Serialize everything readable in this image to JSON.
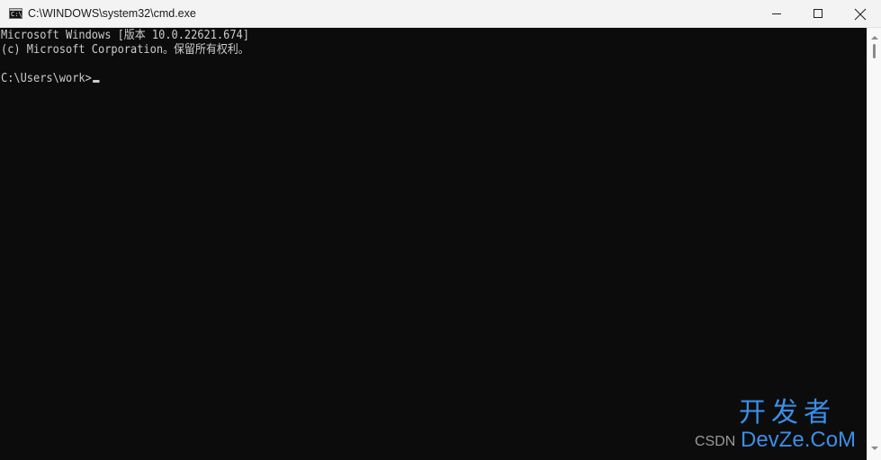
{
  "window": {
    "title": "C:\\WINDOWS\\system32\\cmd.exe",
    "icon": "cmd-icon",
    "icon_label": "C:\\_",
    "controls": [
      "minimize-icon",
      "maximize-icon",
      "close-icon"
    ]
  },
  "console": {
    "lines": [
      "Microsoft Windows [版本 10.0.22621.674]",
      "(c) Microsoft Corporation。保留所有权利。",
      "C:\\Users\\work>"
    ],
    "background": "#0c0c0c",
    "foreground": "#cccccc"
  },
  "scrollbar": {
    "up_icon": "scroll-up-arrow-icon",
    "down_icon": "scroll-down-arrow-icon"
  },
  "watermark": {
    "prefix": "CSDN",
    "brand": "开发者",
    "domain": "DevZe.CoM",
    "color": "#3a8fe8"
  }
}
